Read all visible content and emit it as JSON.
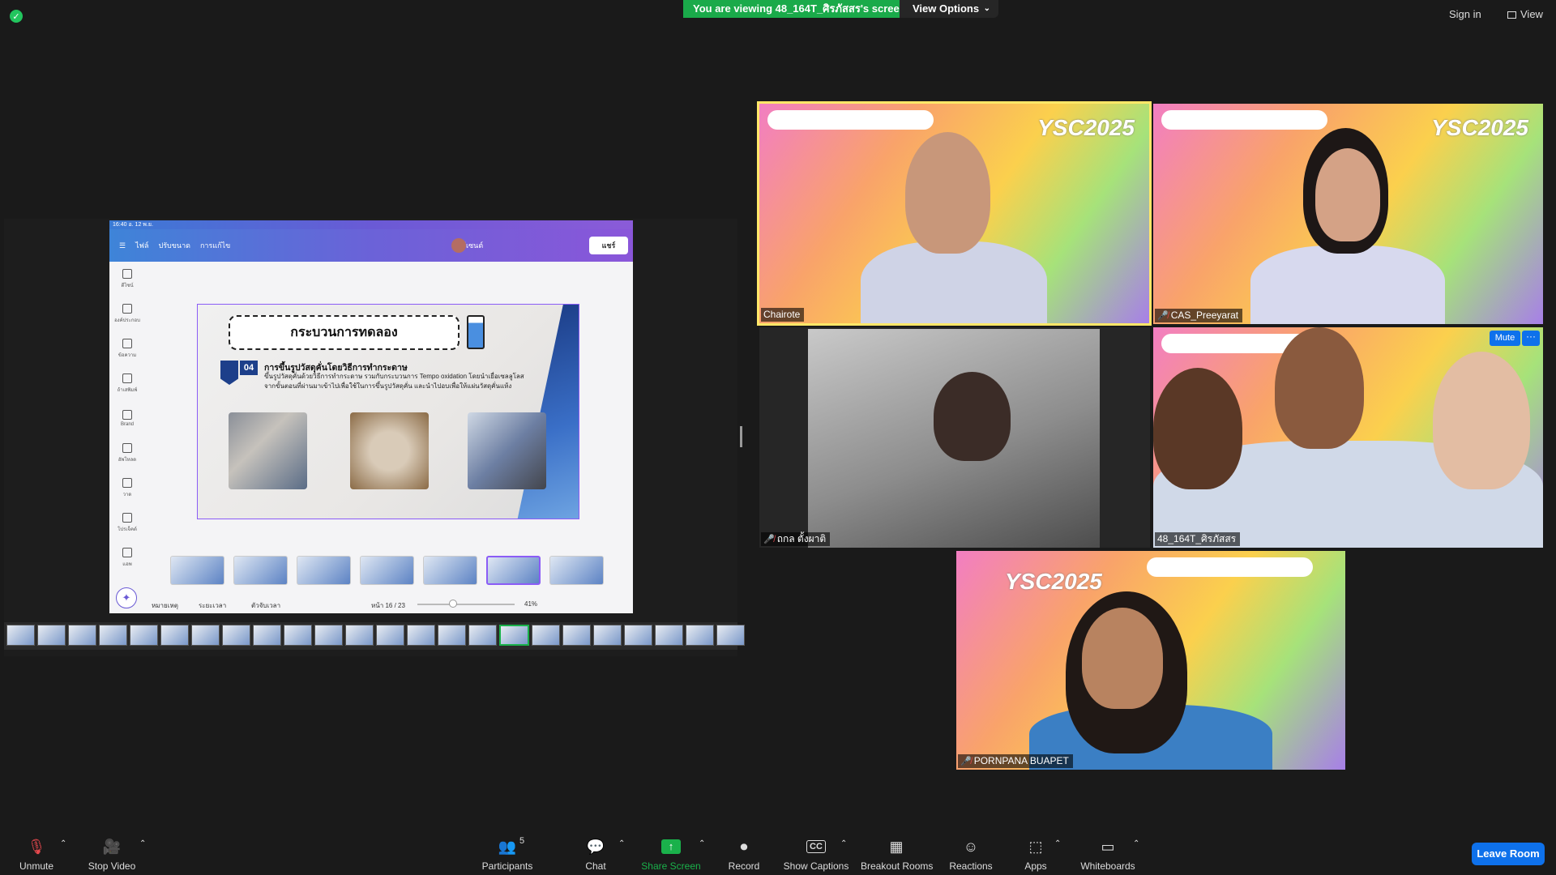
{
  "top": {
    "banner": "You are viewing 48_164T_ศิรภัสสร's screen",
    "view_options": "View Options",
    "sign_in": "Sign in",
    "view": "View"
  },
  "share": {
    "status_time": "16:40  อ. 12 พ.ย.",
    "canva_menu": [
      "ไฟล์",
      "ปรับขนาด",
      "การแก้ไข"
    ],
    "present_label": "พรีเซนต์",
    "share_label": "แชร์",
    "tools": [
      "ดีไซน์",
      "องค์ประกอบ",
      "ข้อความ",
      "ถ้าเสพิมพ์",
      "Brand",
      "อัพโหลด",
      "วาด",
      "โปรเจ็คต์",
      "แอพ"
    ],
    "slide": {
      "title": "กระบวนการทดลอง",
      "number": "04",
      "subtitle": "การขึ้นรูปวัสดุคั่นโดยวิธีการทำกระดาษ",
      "body": "ขึ้นรูปวัสดุคั่นด้วยวิธีการทำกระดาษ รวมกับกระบวนการ Tempo oxidation โดยนำเยื่อเซลลูโลสจากขั้นตอนที่ผ่านมาเข้าไปเพื่อใช้ในการขึ้นรูปวัสดุคั่น และนำไปอบเพื่อให้แผ่นวัสดุคั่นแห้ง"
    },
    "footer": {
      "notes": "หมายเหตุ",
      "duration": "ระยะเวลา",
      "timer": "ตัวจับเวลา",
      "page": "หน้า 16 / 23",
      "zoom": "41%"
    },
    "zoom_level": 0.41
  },
  "participants": [
    {
      "name": "Chairote",
      "muted": false,
      "active": true
    },
    {
      "name": "CAS_Preeyarat",
      "muted": true
    },
    {
      "name": "ถกล ตั้งผาติ",
      "muted": true
    },
    {
      "name": "48_164T_ศิรภัสสร",
      "muted": false
    },
    {
      "name": "PORNPANA BUAPET",
      "muted": true
    }
  ],
  "tile_buttons": {
    "mute": "Mute",
    "more": "···"
  },
  "ysc_text": "YSC2025",
  "toolbar": {
    "unmute": "Unmute",
    "stop_video": "Stop Video",
    "participants": "Participants",
    "participants_count": "5",
    "chat": "Chat",
    "share_screen": "Share Screen",
    "record": "Record",
    "show_captions": "Show Captions",
    "breakout_rooms": "Breakout Rooms",
    "reactions": "Reactions",
    "apps": "Apps",
    "whiteboards": "Whiteboards",
    "leave_room": "Leave Room"
  },
  "colors": {
    "accent": "#0e71eb",
    "green": "#1ab14b",
    "active_speaker": "#ffe768",
    "muted_red": "#e5484d"
  }
}
